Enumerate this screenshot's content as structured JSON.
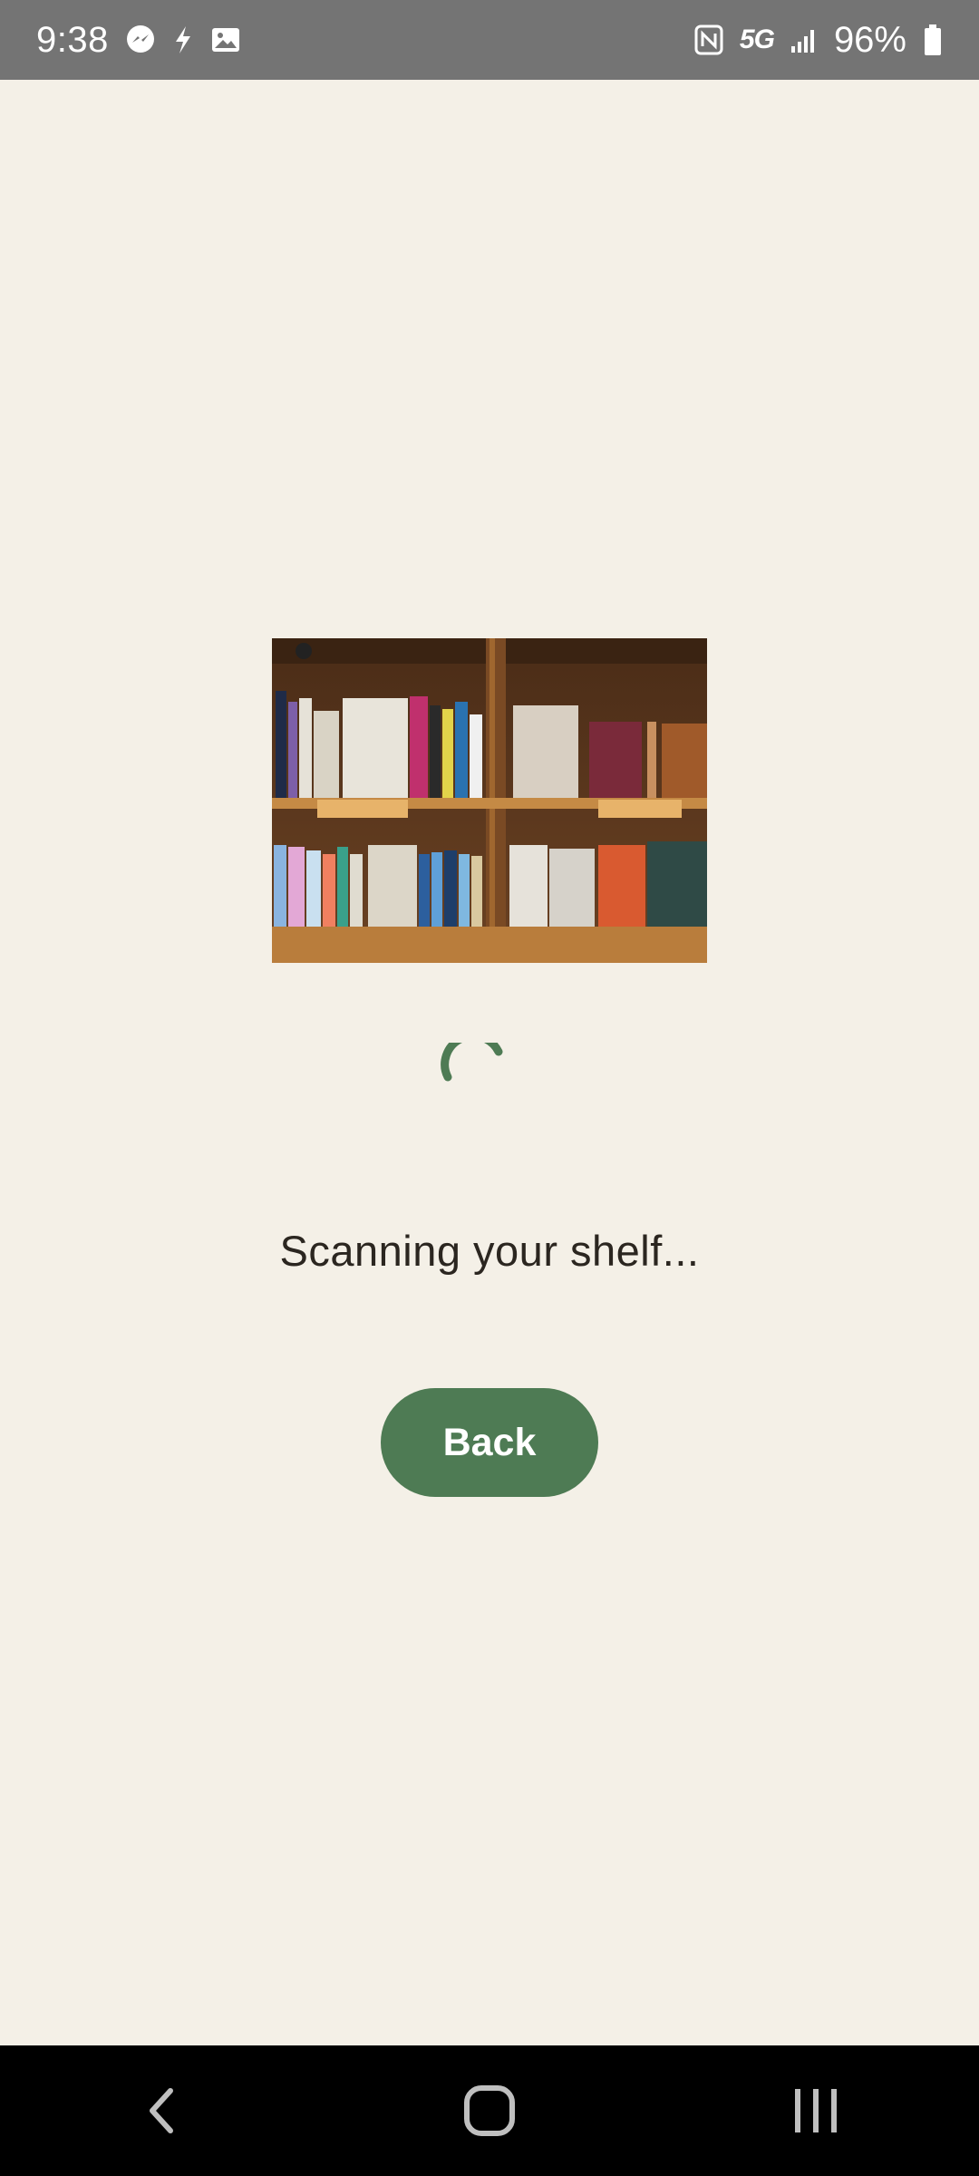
{
  "status_bar": {
    "time": "9:38",
    "left_icons": [
      "messenger-icon",
      "flash-icon",
      "gallery-icon"
    ],
    "right_icons": [
      "nfc-icon",
      "5g-icon",
      "signal-icon",
      "battery-icon"
    ],
    "network": "5G",
    "battery": "96%"
  },
  "main": {
    "image": "bookshelf-photo",
    "loading": true,
    "status_text": "Scanning your shelf...",
    "back_label": "Back"
  },
  "colors": {
    "background": "#f4f0e7",
    "accent": "#4e7b54",
    "status_bar": "#747474",
    "nav_bar": "#000000"
  },
  "nav_bar": {
    "buttons": [
      "back-nav-icon",
      "home-nav-icon",
      "recents-nav-icon"
    ]
  }
}
